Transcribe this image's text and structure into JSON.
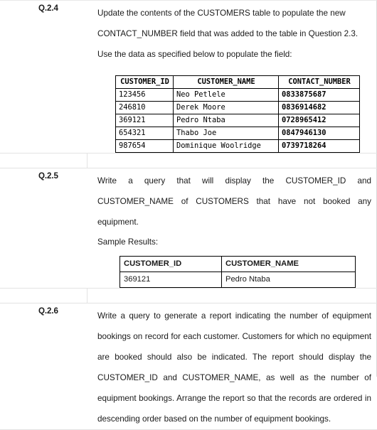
{
  "document": {
    "questions": [
      {
        "label": "Q.2.4",
        "paragraphs": [
          "Update the contents of the CUSTOMERS table to populate the new CONTACT_NUMBER field that was added to the table in Question 2.3. Use the data as specified below to populate the field:"
        ]
      },
      {
        "label": "Q.2.5",
        "paragraphs": [
          "Write a query that will display the CUSTOMER_ID and CUSTOMER_NAME of CUSTOMERS that have not booked any equipment."
        ],
        "sample_results_label": "Sample Results:"
      },
      {
        "label": "Q.2.6",
        "paragraphs": [
          "Write a query to generate a report indicating the number of equipment bookings on record for each customer. Customers for which no equipment are booked should also be indicated. The report should display the CUSTOMER_ID and CUSTOMER_NAME, as well as the number of equipment bookings. Arrange the report so that the records are ordered in descending order based on the number of equipment bookings."
        ]
      }
    ],
    "customers_table": {
      "headers": [
        "CUSTOMER_ID",
        "CUSTOMER_NAME",
        "CONTACT_NUMBER"
      ],
      "rows": [
        [
          "123456",
          "Neo Petlele",
          "0833875687"
        ],
        [
          "246810",
          "Derek Moore",
          "0836914682"
        ],
        [
          "369121",
          "Pedro Ntaba",
          "0728965412"
        ],
        [
          "654321",
          "Thabo Joe",
          "0847946130"
        ],
        [
          "987654",
          "Dominique Woolridge",
          "0739718264"
        ]
      ]
    },
    "sample_results_table": {
      "headers": [
        "CUSTOMER_ID",
        "CUSTOMER_NAME"
      ],
      "rows": [
        [
          "369121",
          "Pedro Ntaba"
        ]
      ]
    }
  }
}
